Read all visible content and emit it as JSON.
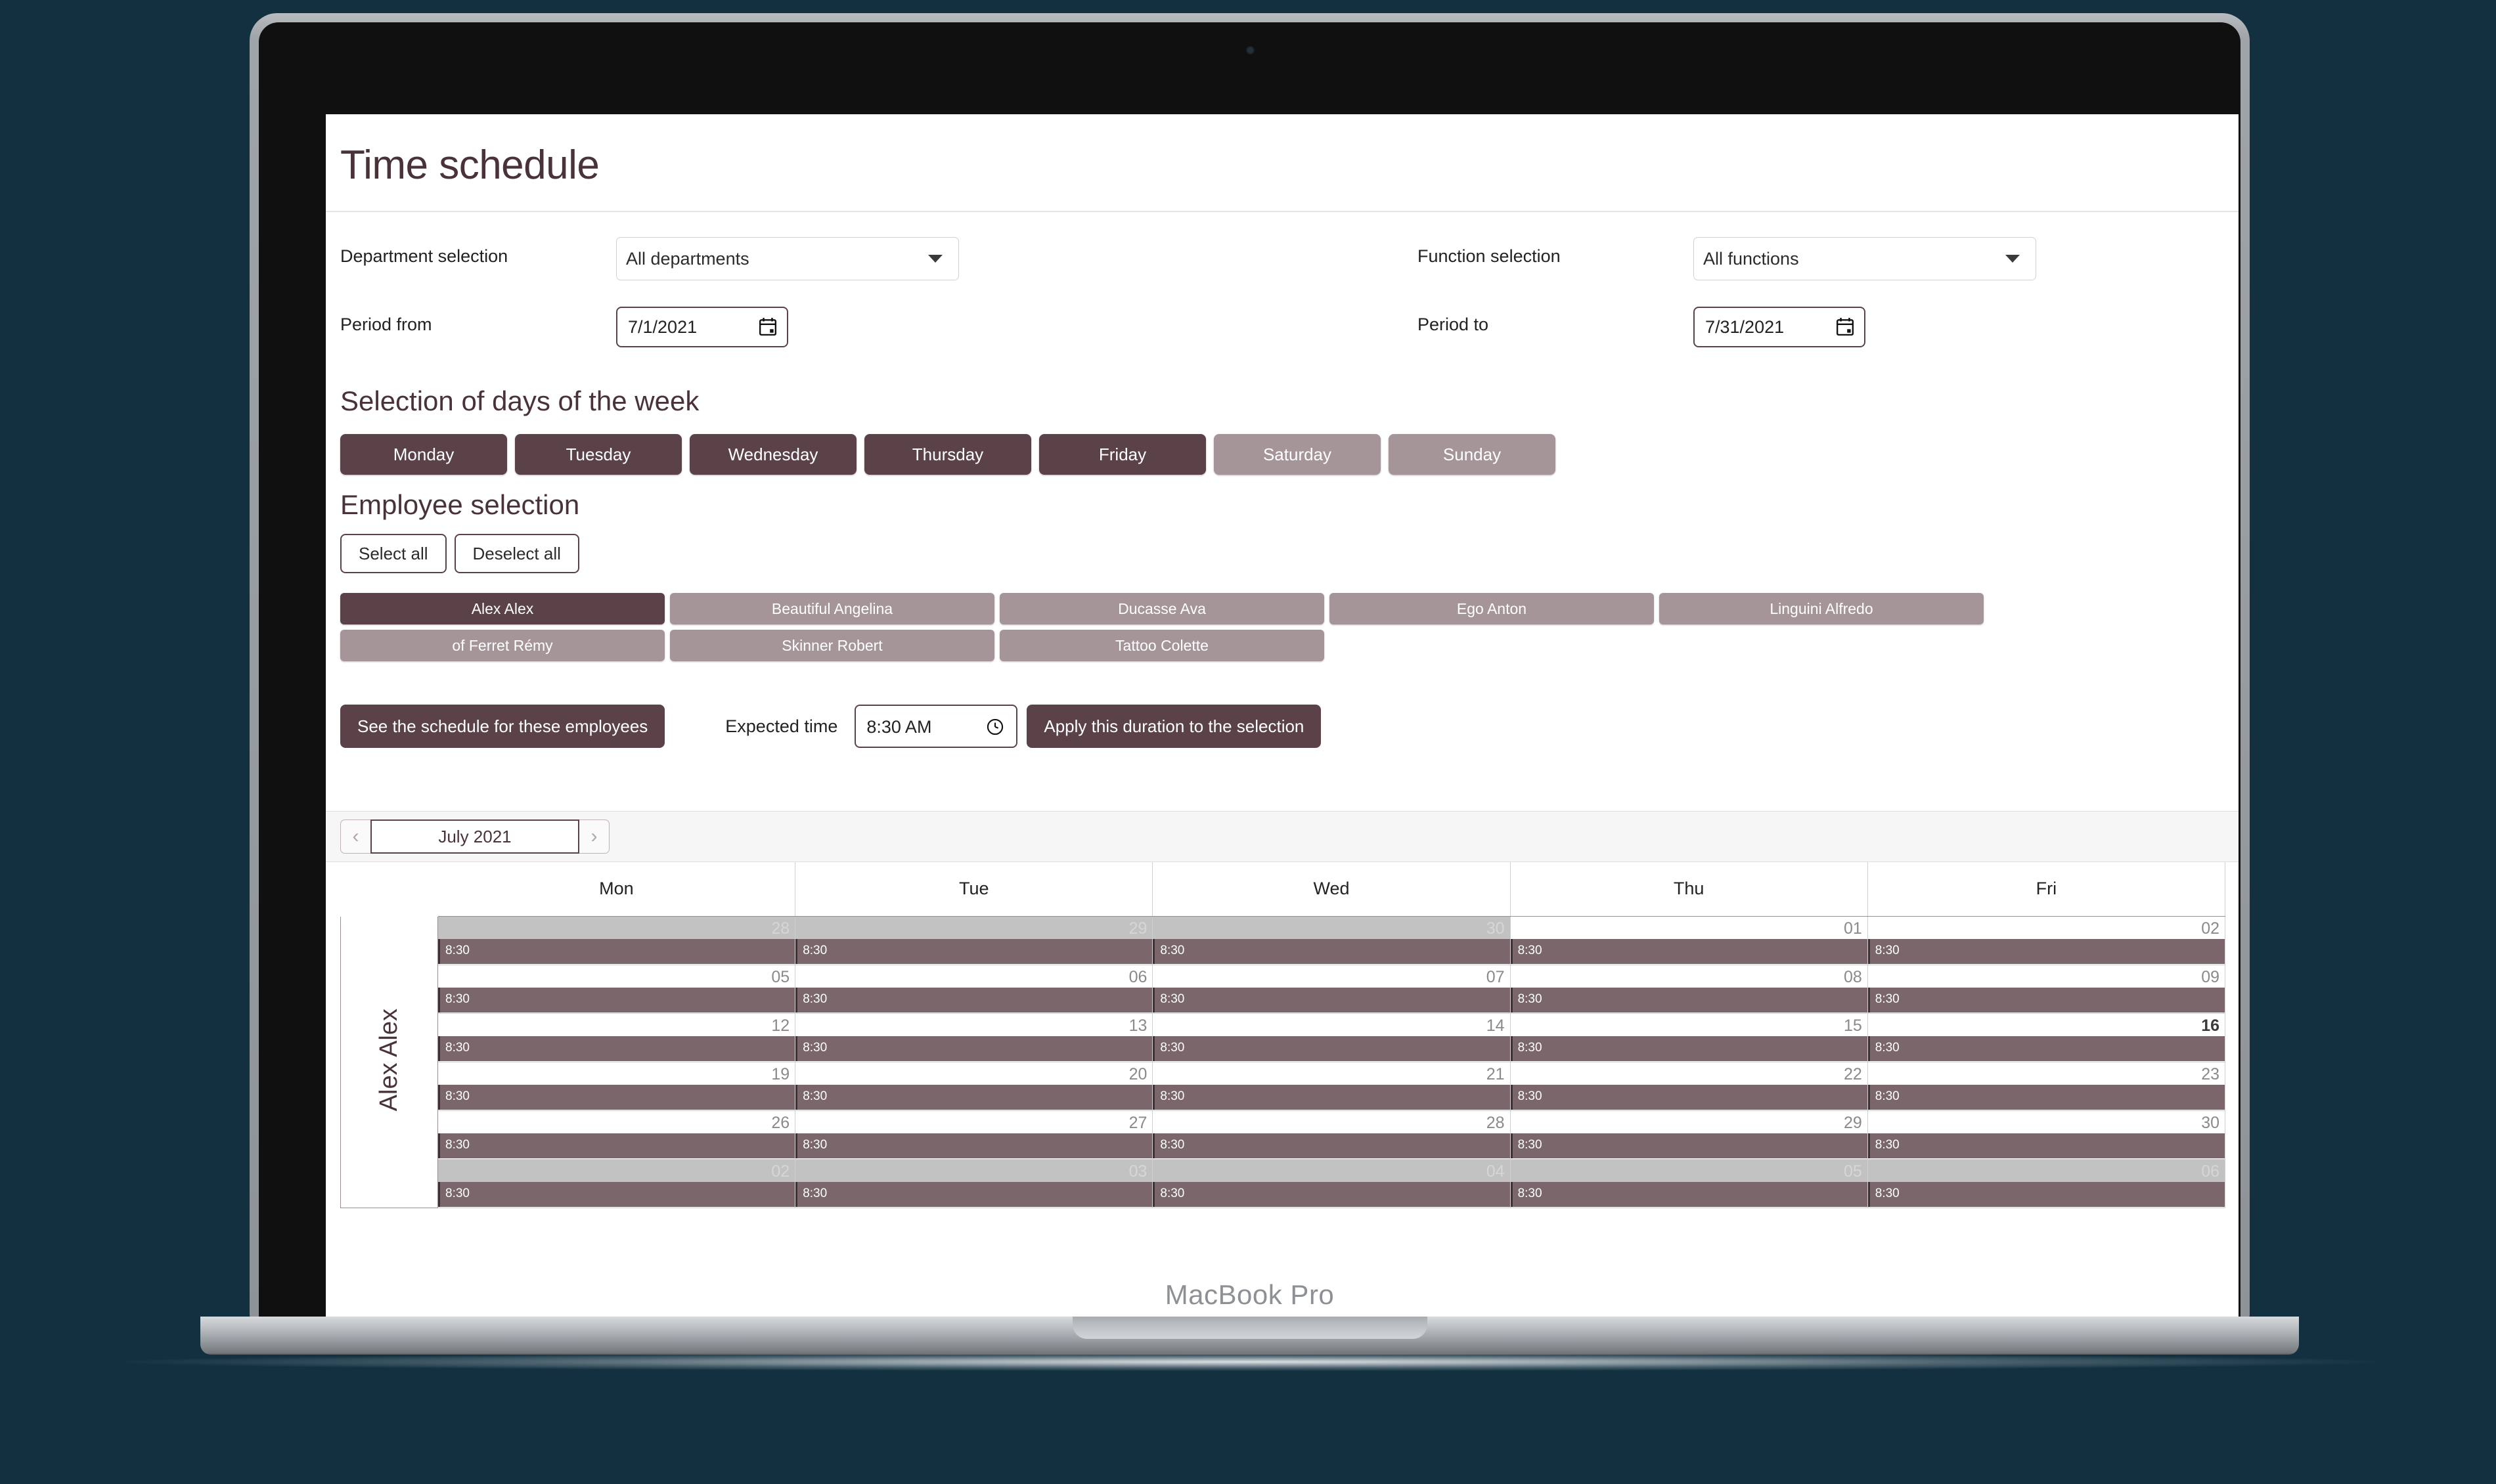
{
  "device": {
    "label": "MacBook Pro"
  },
  "app": {
    "title": "Time schedule",
    "filters": {
      "department_label": "Department selection",
      "department_value": "All departments",
      "function_label": "Function selection",
      "function_value": "All functions",
      "period_from_label": "Period from",
      "period_from_value": "7/1/2021",
      "period_to_label": "Period to",
      "period_to_value": "7/31/2021"
    },
    "days_section": {
      "heading": "Selection of days of the week",
      "days": [
        {
          "label": "Monday",
          "selected": true
        },
        {
          "label": "Tuesday",
          "selected": true
        },
        {
          "label": "Wednesday",
          "selected": true
        },
        {
          "label": "Thursday",
          "selected": true
        },
        {
          "label": "Friday",
          "selected": true
        },
        {
          "label": "Saturday",
          "selected": false
        },
        {
          "label": "Sunday",
          "selected": false
        }
      ]
    },
    "employee_section": {
      "heading": "Employee selection",
      "select_all_label": "Select all",
      "deselect_all_label": "Deselect all",
      "employees": [
        {
          "name": "Alex Alex",
          "selected": true
        },
        {
          "name": "Beautiful Angelina",
          "selected": false
        },
        {
          "name": "Ducasse Ava",
          "selected": false
        },
        {
          "name": "Ego Anton",
          "selected": false
        },
        {
          "name": "Linguini Alfredo",
          "selected": false
        },
        {
          "name": "of Ferret Rémy",
          "selected": false
        },
        {
          "name": "Skinner Robert",
          "selected": false
        },
        {
          "name": "Tattoo Colette",
          "selected": false
        }
      ]
    },
    "actions": {
      "see_schedule_label": "See the schedule for these employees",
      "expected_time_label": "Expected time",
      "expected_time_value": "8:30 AM",
      "apply_duration_label": "Apply this duration to the selection"
    },
    "calendar": {
      "prev_label": "‹",
      "next_label": "›",
      "month_label": "July 2021",
      "row_name": "Alex Alex",
      "weekday_headers": [
        "Mon",
        "Tue",
        "Wed",
        "Thu",
        "Fri"
      ],
      "slot_time": "8:30",
      "weeks": [
        [
          {
            "day": "28",
            "other_month": true,
            "today": false,
            "slot": "8:30"
          },
          {
            "day": "29",
            "other_month": true,
            "today": false,
            "slot": "8:30"
          },
          {
            "day": "30",
            "other_month": true,
            "today": false,
            "slot": "8:30"
          },
          {
            "day": "01",
            "other_month": false,
            "today": false,
            "slot": "8:30"
          },
          {
            "day": "02",
            "other_month": false,
            "today": false,
            "slot": "8:30"
          }
        ],
        [
          {
            "day": "05",
            "other_month": false,
            "today": false,
            "slot": "8:30"
          },
          {
            "day": "06",
            "other_month": false,
            "today": false,
            "slot": "8:30"
          },
          {
            "day": "07",
            "other_month": false,
            "today": false,
            "slot": "8:30"
          },
          {
            "day": "08",
            "other_month": false,
            "today": false,
            "slot": "8:30"
          },
          {
            "day": "09",
            "other_month": false,
            "today": false,
            "slot": "8:30"
          }
        ],
        [
          {
            "day": "12",
            "other_month": false,
            "today": false,
            "slot": "8:30"
          },
          {
            "day": "13",
            "other_month": false,
            "today": false,
            "slot": "8:30"
          },
          {
            "day": "14",
            "other_month": false,
            "today": false,
            "slot": "8:30"
          },
          {
            "day": "15",
            "other_month": false,
            "today": false,
            "slot": "8:30"
          },
          {
            "day": "16",
            "other_month": false,
            "today": true,
            "slot": "8:30"
          }
        ],
        [
          {
            "day": "19",
            "other_month": false,
            "today": false,
            "slot": "8:30"
          },
          {
            "day": "20",
            "other_month": false,
            "today": false,
            "slot": "8:30"
          },
          {
            "day": "21",
            "other_month": false,
            "today": false,
            "slot": "8:30"
          },
          {
            "day": "22",
            "other_month": false,
            "today": false,
            "slot": "8:30"
          },
          {
            "day": "23",
            "other_month": false,
            "today": false,
            "slot": "8:30"
          }
        ],
        [
          {
            "day": "26",
            "other_month": false,
            "today": false,
            "slot": "8:30"
          },
          {
            "day": "27",
            "other_month": false,
            "today": false,
            "slot": "8:30"
          },
          {
            "day": "28",
            "other_month": false,
            "today": false,
            "slot": "8:30"
          },
          {
            "day": "29",
            "other_month": false,
            "today": false,
            "slot": "8:30"
          },
          {
            "day": "30",
            "other_month": false,
            "today": false,
            "slot": "8:30"
          }
        ],
        [
          {
            "day": "02",
            "other_month": true,
            "today": false,
            "slot": "8:30"
          },
          {
            "day": "03",
            "other_month": true,
            "today": false,
            "slot": "8:30"
          },
          {
            "day": "04",
            "other_month": true,
            "today": false,
            "slot": "8:30"
          },
          {
            "day": "05",
            "other_month": true,
            "today": false,
            "slot": "8:30"
          },
          {
            "day": "06",
            "other_month": true,
            "today": false,
            "slot": "8:30"
          }
        ]
      ]
    },
    "colors": {
      "accent_dark": "#5b4249",
      "accent_light": "#a59599",
      "slot": "#7b666c",
      "title": "#4a3338",
      "desktop_bg": "#123040"
    }
  }
}
